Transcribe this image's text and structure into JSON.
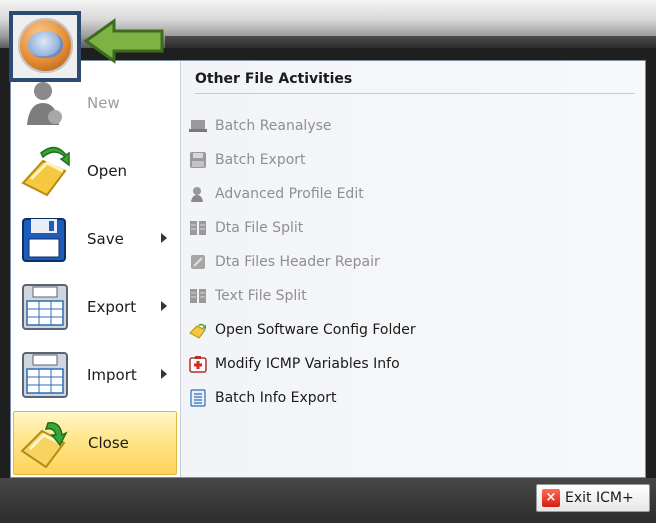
{
  "app": {
    "orb_icon": "brain-orb-icon"
  },
  "left_menu": [
    {
      "label": "New",
      "icon": "new-user-icon",
      "disabled": true,
      "submenu": false
    },
    {
      "label": "Open",
      "icon": "open-folder-icon",
      "disabled": false,
      "submenu": false
    },
    {
      "label": "Save",
      "icon": "save-floppy-icon",
      "disabled": false,
      "submenu": true
    },
    {
      "label": "Export",
      "icon": "export-spreadsheet-icon",
      "disabled": false,
      "submenu": true
    },
    {
      "label": "Import",
      "icon": "import-spreadsheet-icon",
      "disabled": false,
      "submenu": true
    },
    {
      "label": "Close",
      "icon": "close-folder-icon",
      "disabled": false,
      "submenu": false,
      "selected": true
    }
  ],
  "right_panel": {
    "heading": "Other File Activities",
    "items": [
      {
        "label": "Batch Reanalyse",
        "icon": "batch-reanalyse-icon",
        "disabled": true
      },
      {
        "label": "Batch Export",
        "icon": "batch-export-icon",
        "disabled": true
      },
      {
        "label": "Advanced Profile Edit",
        "icon": "profile-edit-icon",
        "disabled": true
      },
      {
        "label": "Dta File Split",
        "icon": "file-split-icon",
        "disabled": true
      },
      {
        "label": "Dta Files Header Repair",
        "icon": "header-repair-icon",
        "disabled": true
      },
      {
        "label": "Text File Split",
        "icon": "text-split-icon",
        "disabled": true
      },
      {
        "label": "Open Software Config Folder",
        "icon": "config-folder-icon",
        "disabled": false
      },
      {
        "label": "Modify ICMP Variables Info",
        "icon": "first-aid-icon",
        "disabled": false
      },
      {
        "label": "Batch Info Export",
        "icon": "document-list-icon",
        "disabled": false
      }
    ]
  },
  "footer": {
    "exit_label": "Exit ICM+"
  },
  "colors": {
    "selected_bg": "#ffd35a",
    "callout_arrow": "#7cb342",
    "orb_frame": "#2d4a73"
  }
}
